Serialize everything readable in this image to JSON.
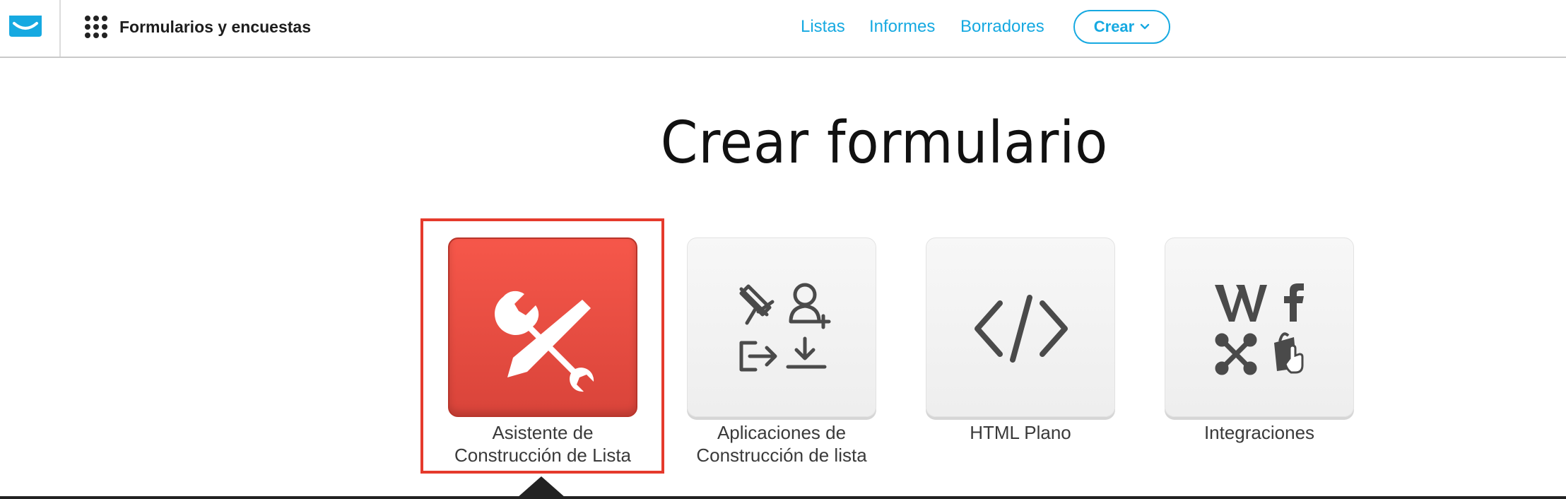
{
  "header": {
    "app_title": "Formularios y encuestas",
    "nav": [
      {
        "label": "Listas"
      },
      {
        "label": "Informes"
      },
      {
        "label": "Borradores"
      }
    ],
    "create_label": "Crear"
  },
  "main": {
    "title": "Crear formulario",
    "options": [
      {
        "label": "Asistente de\nConstrucción de Lista",
        "icon": "tools-icon",
        "selected": true
      },
      {
        "label": "Aplicaciones de\nConstrucción de lista",
        "icon": "list-apps-icon",
        "selected": false
      },
      {
        "label": "HTML Plano",
        "icon": "code-icon",
        "selected": false
      },
      {
        "label": "Integraciones",
        "icon": "integrations-icon",
        "selected": false
      }
    ]
  },
  "colors": {
    "accent": "#16a9e1",
    "selected_tile": "#f0503f",
    "selection_border": "#e53a2c",
    "icon_gray": "#4a4a4a"
  }
}
